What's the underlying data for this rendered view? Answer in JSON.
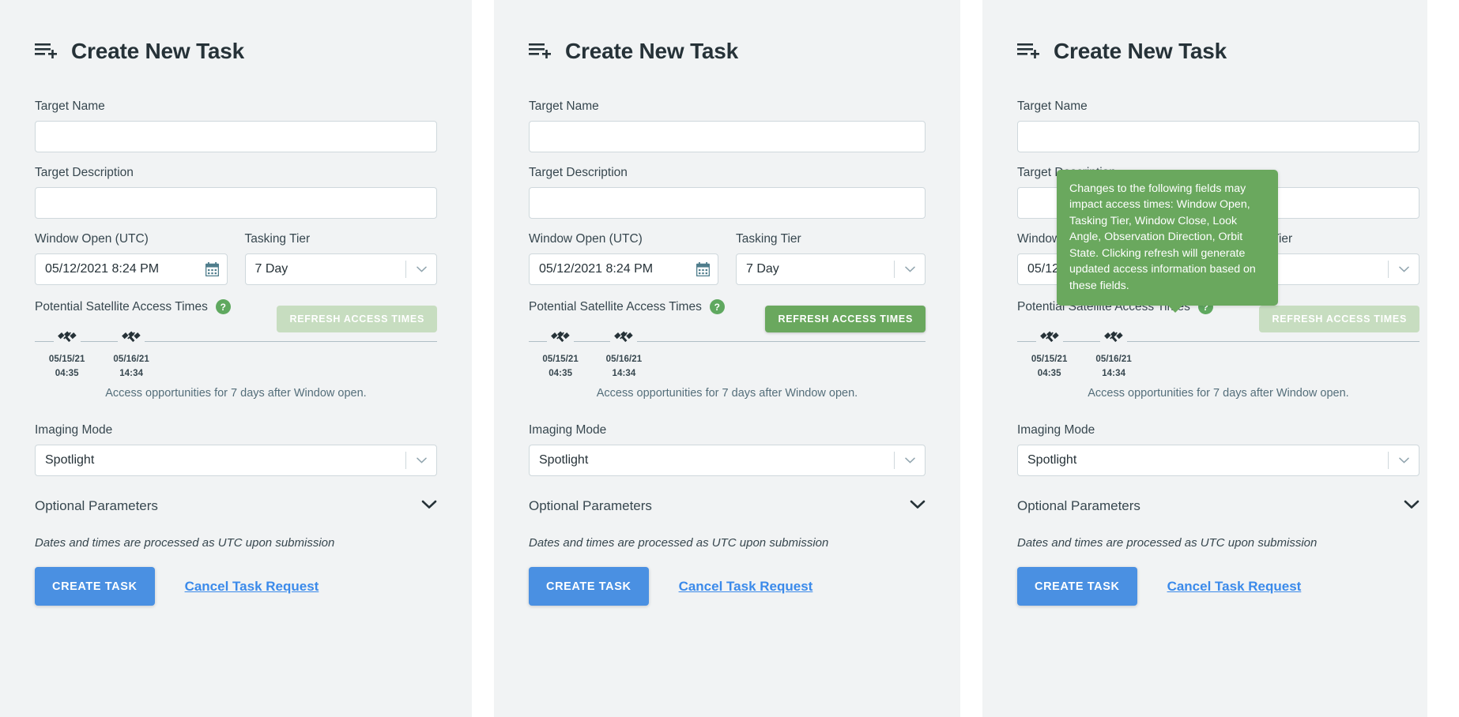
{
  "form": {
    "header": {
      "icon": "playlist-add-icon",
      "title": "Create New Task"
    },
    "target_name": {
      "label": "Target Name",
      "value": "",
      "placeholder": ""
    },
    "target_description": {
      "label": "Target Description",
      "value": "",
      "placeholder": ""
    },
    "window_open": {
      "label": "Window Open (UTC)",
      "value": "05/12/2021 8:24 PM",
      "icon": "calendar-icon"
    },
    "tasking_tier": {
      "label": "Tasking Tier",
      "value": "7 Day",
      "icon": "chevron-down-icon"
    },
    "access_times": {
      "label": "Potential Satellite Access Times",
      "help_icon": "?",
      "refresh_label": "REFRESH ACCESS TIMES",
      "note": "Access opportunities for 7 days after Window open."
    },
    "imaging_mode": {
      "label": "Imaging Mode",
      "value": "Spotlight",
      "icon": "chevron-down-icon"
    },
    "optional_parameters": {
      "label": "Optional Parameters",
      "icon": "chevron-down-icon"
    },
    "utc_note": "Dates and times are processed as UTC upon submission",
    "create_label": "CREATE TASK",
    "cancel_label": "Cancel Task Request"
  },
  "tooltip": {
    "text": "Changes to the following fields may impact access times: Window Open, Tasking Tier, Window Close, Look Angle, Observation Direction, Orbit State. Clicking refresh will generate updated access information based on these fields."
  },
  "chart_data": {
    "type": "timeline",
    "title": "Potential Satellite Access Times",
    "xlabel": "",
    "ylabel": "",
    "axis_range": [
      "05/12/21 20:24",
      "05/19/21 20:24"
    ],
    "grid": false,
    "legend": "none",
    "events": [
      {
        "date": "05/15/21",
        "time": "04:35",
        "icon": "satellite-icon",
        "position_pct": 8
      },
      {
        "date": "05/16/21",
        "time": "14:34",
        "icon": "satellite-icon",
        "position_pct": 24
      }
    ]
  },
  "panels": [
    {
      "refresh_enabled": false,
      "tooltip_visible": false
    },
    {
      "refresh_enabled": true,
      "tooltip_visible": false
    },
    {
      "refresh_enabled": false,
      "tooltip_visible": true
    }
  ]
}
